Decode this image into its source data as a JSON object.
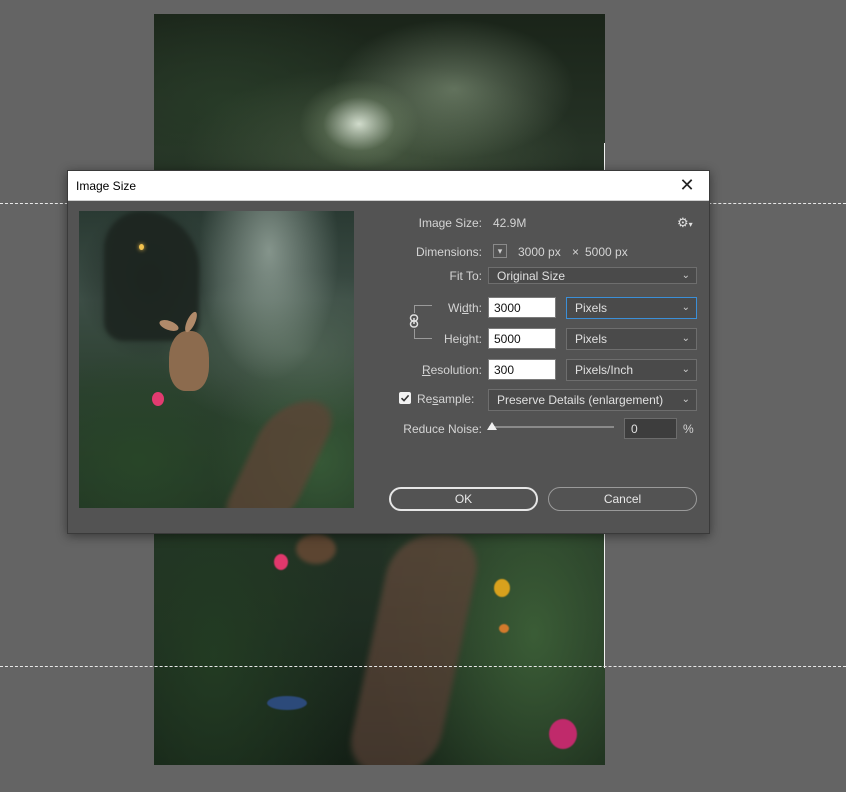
{
  "dialog": {
    "title": "Image Size",
    "close_icon": "close-icon"
  },
  "info": {
    "image_size_label": "Image Size:",
    "image_size_value": "42.9M",
    "dimensions_label": "Dimensions:",
    "dimensions_width": "3000 px",
    "dimensions_times": "×",
    "dimensions_height": "5000 px",
    "settings_icon": "gear-icon"
  },
  "fit_to": {
    "label": "Fit To:",
    "selected": "Original Size"
  },
  "width": {
    "label_pre": "Wi",
    "label_ul": "d",
    "label_post": "th:",
    "value": "3000",
    "unit": "Pixels"
  },
  "height": {
    "label_pre": "Hei",
    "label_ul": "g",
    "label_post": "ht:",
    "value": "5000",
    "unit": "Pixels"
  },
  "resolution": {
    "label_ul": "R",
    "label_post": "esolution:",
    "value": "300",
    "unit": "Pixels/Inch"
  },
  "resample": {
    "label_pre": "Re",
    "label_ul": "s",
    "label_post": "ample:",
    "checked": true,
    "selected": "Preserve Details (enlargement)"
  },
  "reduce_noise": {
    "label": "Reduce Noise:",
    "value": "0",
    "unit": "%",
    "slider_fraction": 0
  },
  "buttons": {
    "ok": "OK",
    "cancel": "Cancel"
  },
  "colors": {
    "workspace": "#646464",
    "dialog_bg": "#535353",
    "focus_border": "#3b8fd8"
  }
}
